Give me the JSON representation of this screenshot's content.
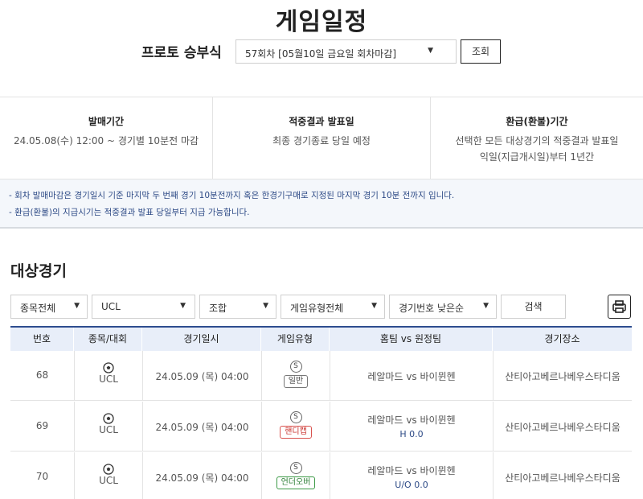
{
  "page": {
    "title": "게임일정"
  },
  "round": {
    "label": "프로토 승부식",
    "selected": "57회차 [05월10일 금요일 회차마감]",
    "query_label": "조회"
  },
  "info": [
    {
      "head": "발매기간",
      "body": "24.05.08(수) 12:00 ~ 경기별 10분전 마감",
      "body2": ""
    },
    {
      "head": "적중결과 발표일",
      "body": "최종 경기종료 당일 예정",
      "body2": ""
    },
    {
      "head": "환급(환불)기간",
      "body": "선택한 모든 대상경기의 적중결과 발표일",
      "body2": "익일(지급개시일)부터 1년간"
    }
  ],
  "notices": [
    "- 회차 발매마감은 경기일시 기준 마지막 두 번째 경기 10분전까지 혹은 한경기구매로 지정된 마지막 경기 10분 전까지 입니다.",
    "- 환급(환불)의 지급시기는 적중결과 발표 당일부터 지급 가능합니다."
  ],
  "section": {
    "title": "대상경기"
  },
  "filters": {
    "sport": "종목전체",
    "league": "UCL",
    "combo": "조합",
    "game_type": "게임유형전체",
    "sort": "경기번호 낮은순",
    "search_label": "검색",
    "print_icon": "printer-icon"
  },
  "table": {
    "headers": [
      "번호",
      "종목/대회",
      "경기일시",
      "게임유형",
      "홈팀 vs 원정팀",
      "경기장소"
    ],
    "rows": [
      {
        "no": "68",
        "league": "UCL",
        "datetime": "24.05.09 (목) 04:00",
        "s": "S",
        "type": "일반",
        "type_color": "gray",
        "home": "레알마드",
        "vs": "vs",
        "away": "바이뮌헨",
        "sub": "",
        "venue": "산티아고베르나베우스타디움"
      },
      {
        "no": "69",
        "league": "UCL",
        "datetime": "24.05.09 (목) 04:00",
        "s": "S",
        "type": "핸디캡",
        "type_color": "red",
        "home": "레알마드",
        "vs": "vs",
        "away": "바이뮌헨",
        "sub": "H 0.0",
        "venue": "산티아고베르나베우스타디움"
      },
      {
        "no": "70",
        "league": "UCL",
        "datetime": "24.05.09 (목) 04:00",
        "s": "S",
        "type": "언더오버",
        "type_color": "green",
        "home": "레알마드",
        "vs": "vs",
        "away": "바이뮌헨",
        "sub": "U/O 0.0",
        "venue": "산티아고베르나베우스타디움"
      }
    ]
  },
  "colors": {
    "accent": "#2e4d8f",
    "header_bg": "#e8eef9",
    "notice_bg": "#f4f7fb",
    "handicap": "#d9534f",
    "underover": "#3c9a46"
  }
}
